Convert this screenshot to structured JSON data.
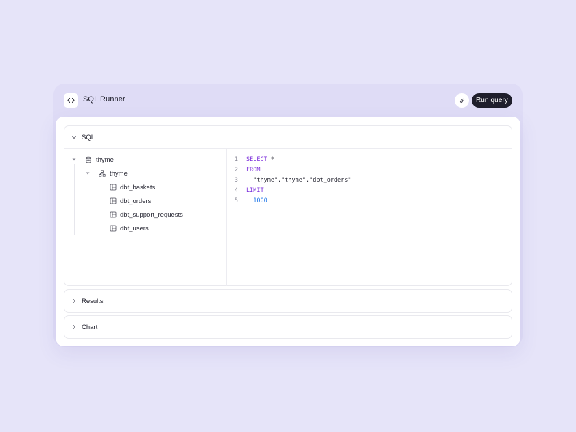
{
  "app": {
    "title": "SQL Runner",
    "icon": "code-icon"
  },
  "toolbar": {
    "link_icon": "link-icon",
    "run_label": "Run query"
  },
  "sql_section": {
    "label": "SQL",
    "expanded": true
  },
  "tree": {
    "database": "thyme",
    "schema": "thyme",
    "tables": [
      "dbt_baskets",
      "dbt_orders",
      "dbt_support_requests",
      "dbt_users"
    ]
  },
  "editor": {
    "lines": [
      {
        "number": "1",
        "text": "SELECT *"
      },
      {
        "number": "2",
        "text": "FROM"
      },
      {
        "number": "3",
        "text": "  \"thyme\".\"thyme\".\"dbt_orders\""
      },
      {
        "number": "4",
        "text": "LIMIT"
      },
      {
        "number": "5",
        "text": "  1000"
      }
    ]
  },
  "results_section": {
    "label": "Results",
    "expanded": false
  },
  "chart_section": {
    "label": "Chart",
    "expanded": false
  },
  "colors": {
    "background": "#e6e4f9",
    "button": "#1f1e2c",
    "keyword": "#7b2ddb",
    "number": "#1a73e8"
  }
}
